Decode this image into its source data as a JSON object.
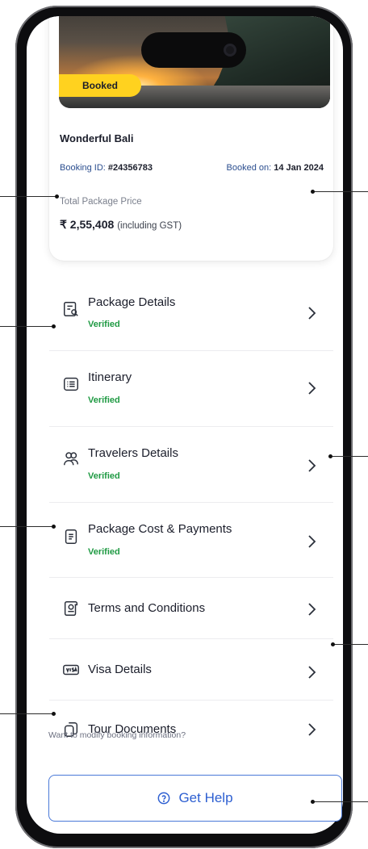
{
  "booking": {
    "status_badge": "Booked",
    "title": "Wonderful Bali",
    "booking_id_label": "Booking ID: ",
    "booking_id": "#24356783",
    "booked_on_label": "Booked on: ",
    "booked_on": "14 Jan 2024",
    "price_label": "Total Package Price",
    "price": "₹ 2,55,408",
    "price_note": "(including GST)"
  },
  "menu": [
    {
      "label": "Package Details",
      "status": "Verified",
      "icon": "document-search-icon"
    },
    {
      "label": "Itinerary",
      "status": "Verified",
      "icon": "list-icon"
    },
    {
      "label": "Travelers Details",
      "status": "Verified",
      "icon": "users-icon"
    },
    {
      "label": "Package Cost & Payments",
      "status": "Verified",
      "icon": "receipt-icon"
    },
    {
      "label": "Terms and Conditions",
      "status": "",
      "icon": "scroll-icon"
    },
    {
      "label": "Visa Details",
      "status": "",
      "icon": "visa-card-icon"
    },
    {
      "label": "Tour Documents",
      "status": "",
      "icon": "documents-icon"
    }
  ],
  "footer": {
    "modify_text": "Want to modify booking information?",
    "help_label": "Get Help"
  },
  "colors": {
    "accent": "#2d5fd1",
    "badge": "#ffd21f",
    "verified": "#1f9a43"
  }
}
